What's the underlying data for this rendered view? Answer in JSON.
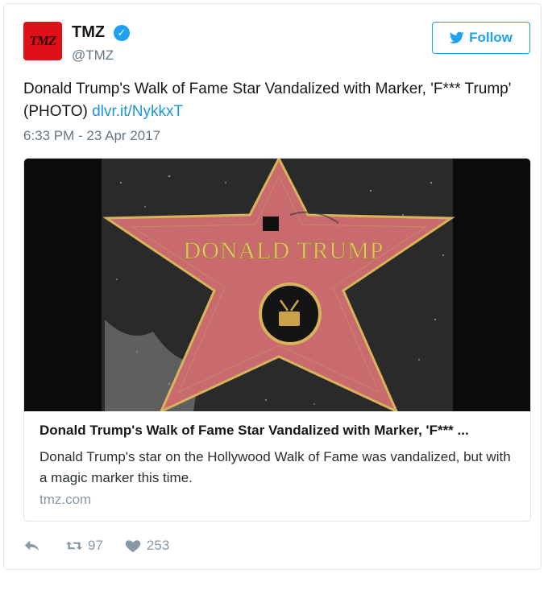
{
  "author": {
    "name": "TMZ",
    "handle": "@TMZ",
    "avatar_text": "TMZ",
    "verified_glyph": "✓"
  },
  "follow_label": "Follow",
  "tweet": {
    "text": "Donald Trump's Walk of Fame Star Vandalized with Marker, 'F*** Trump' (PHOTO) ",
    "link_text": "dlvr.it/NykkxT",
    "timestamp": "6:33 PM - 23 Apr 2017"
  },
  "card": {
    "image_text": "DONALD TRUMP",
    "title": "Donald Trump's Walk of Fame Star Vandalized with Marker, 'F*** ...",
    "description": "Donald Trump's star on the Hollywood Walk of Fame was vandalized, but with a magic marker this time.",
    "domain": "tmz.com"
  },
  "actions": {
    "reply_icon": "reply-icon",
    "retweet_icon": "retweet-icon",
    "retweet_count": "97",
    "like_icon": "heart-icon",
    "like_count": "253"
  },
  "colors": {
    "accent": "#1da1f2",
    "link": "#1b95e0",
    "muted": "#657786",
    "avatar_bg": "#e0101a",
    "star_fill": "#c96a6e",
    "star_border": "#c9a24a"
  }
}
